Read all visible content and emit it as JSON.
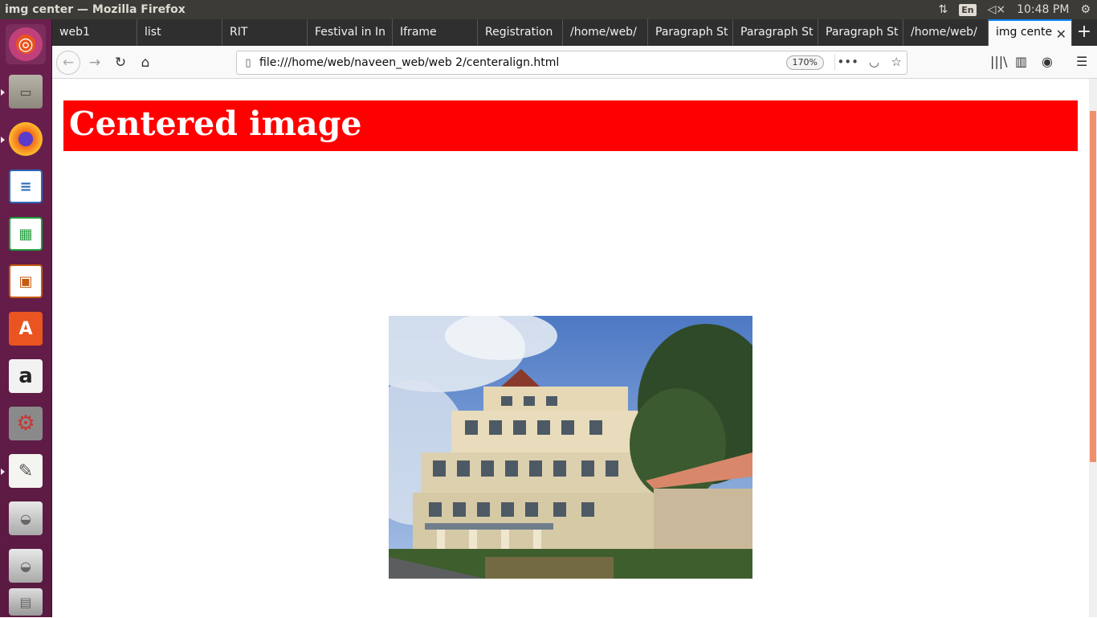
{
  "window": {
    "title": "img center — Mozilla Firefox",
    "keyboard_layout": "En",
    "clock": "10:48 PM"
  },
  "launcher": {
    "items": [
      {
        "name": "ubuntu-dash-icon"
      },
      {
        "name": "files-icon"
      },
      {
        "name": "firefox-icon"
      },
      {
        "name": "libreoffice-writer-icon"
      },
      {
        "name": "libreoffice-calc-icon"
      },
      {
        "name": "libreoffice-impress-icon"
      },
      {
        "name": "ubuntu-software-icon"
      },
      {
        "name": "amazon-icon"
      },
      {
        "name": "system-settings-icon"
      },
      {
        "name": "text-editor-icon"
      },
      {
        "name": "drive-icon"
      },
      {
        "name": "drive-icon"
      },
      {
        "name": "trash-icon"
      }
    ]
  },
  "tabs": [
    {
      "label": "web1"
    },
    {
      "label": "list"
    },
    {
      "label": "RIT"
    },
    {
      "label": "Festival in In"
    },
    {
      "label": "Iframe"
    },
    {
      "label": "Registration"
    },
    {
      "label": "/home/web/"
    },
    {
      "label": "Paragraph St"
    },
    {
      "label": "Paragraph St"
    },
    {
      "label": "Paragraph St"
    },
    {
      "label": "/home/web/"
    }
  ],
  "active_tab": {
    "label": "img cente"
  },
  "nav": {
    "url": "file:///home/web/naveen_web/web 2/centeralign.html",
    "zoom": "170%"
  },
  "page": {
    "heading": "Centered image",
    "heading_bg": "#ff0000",
    "heading_color": "#ffffff"
  },
  "colors": {
    "launcher_bg": "#5e1b47",
    "panel_bg": "#3c3b37",
    "scroll_thumb": "#f0906a"
  }
}
